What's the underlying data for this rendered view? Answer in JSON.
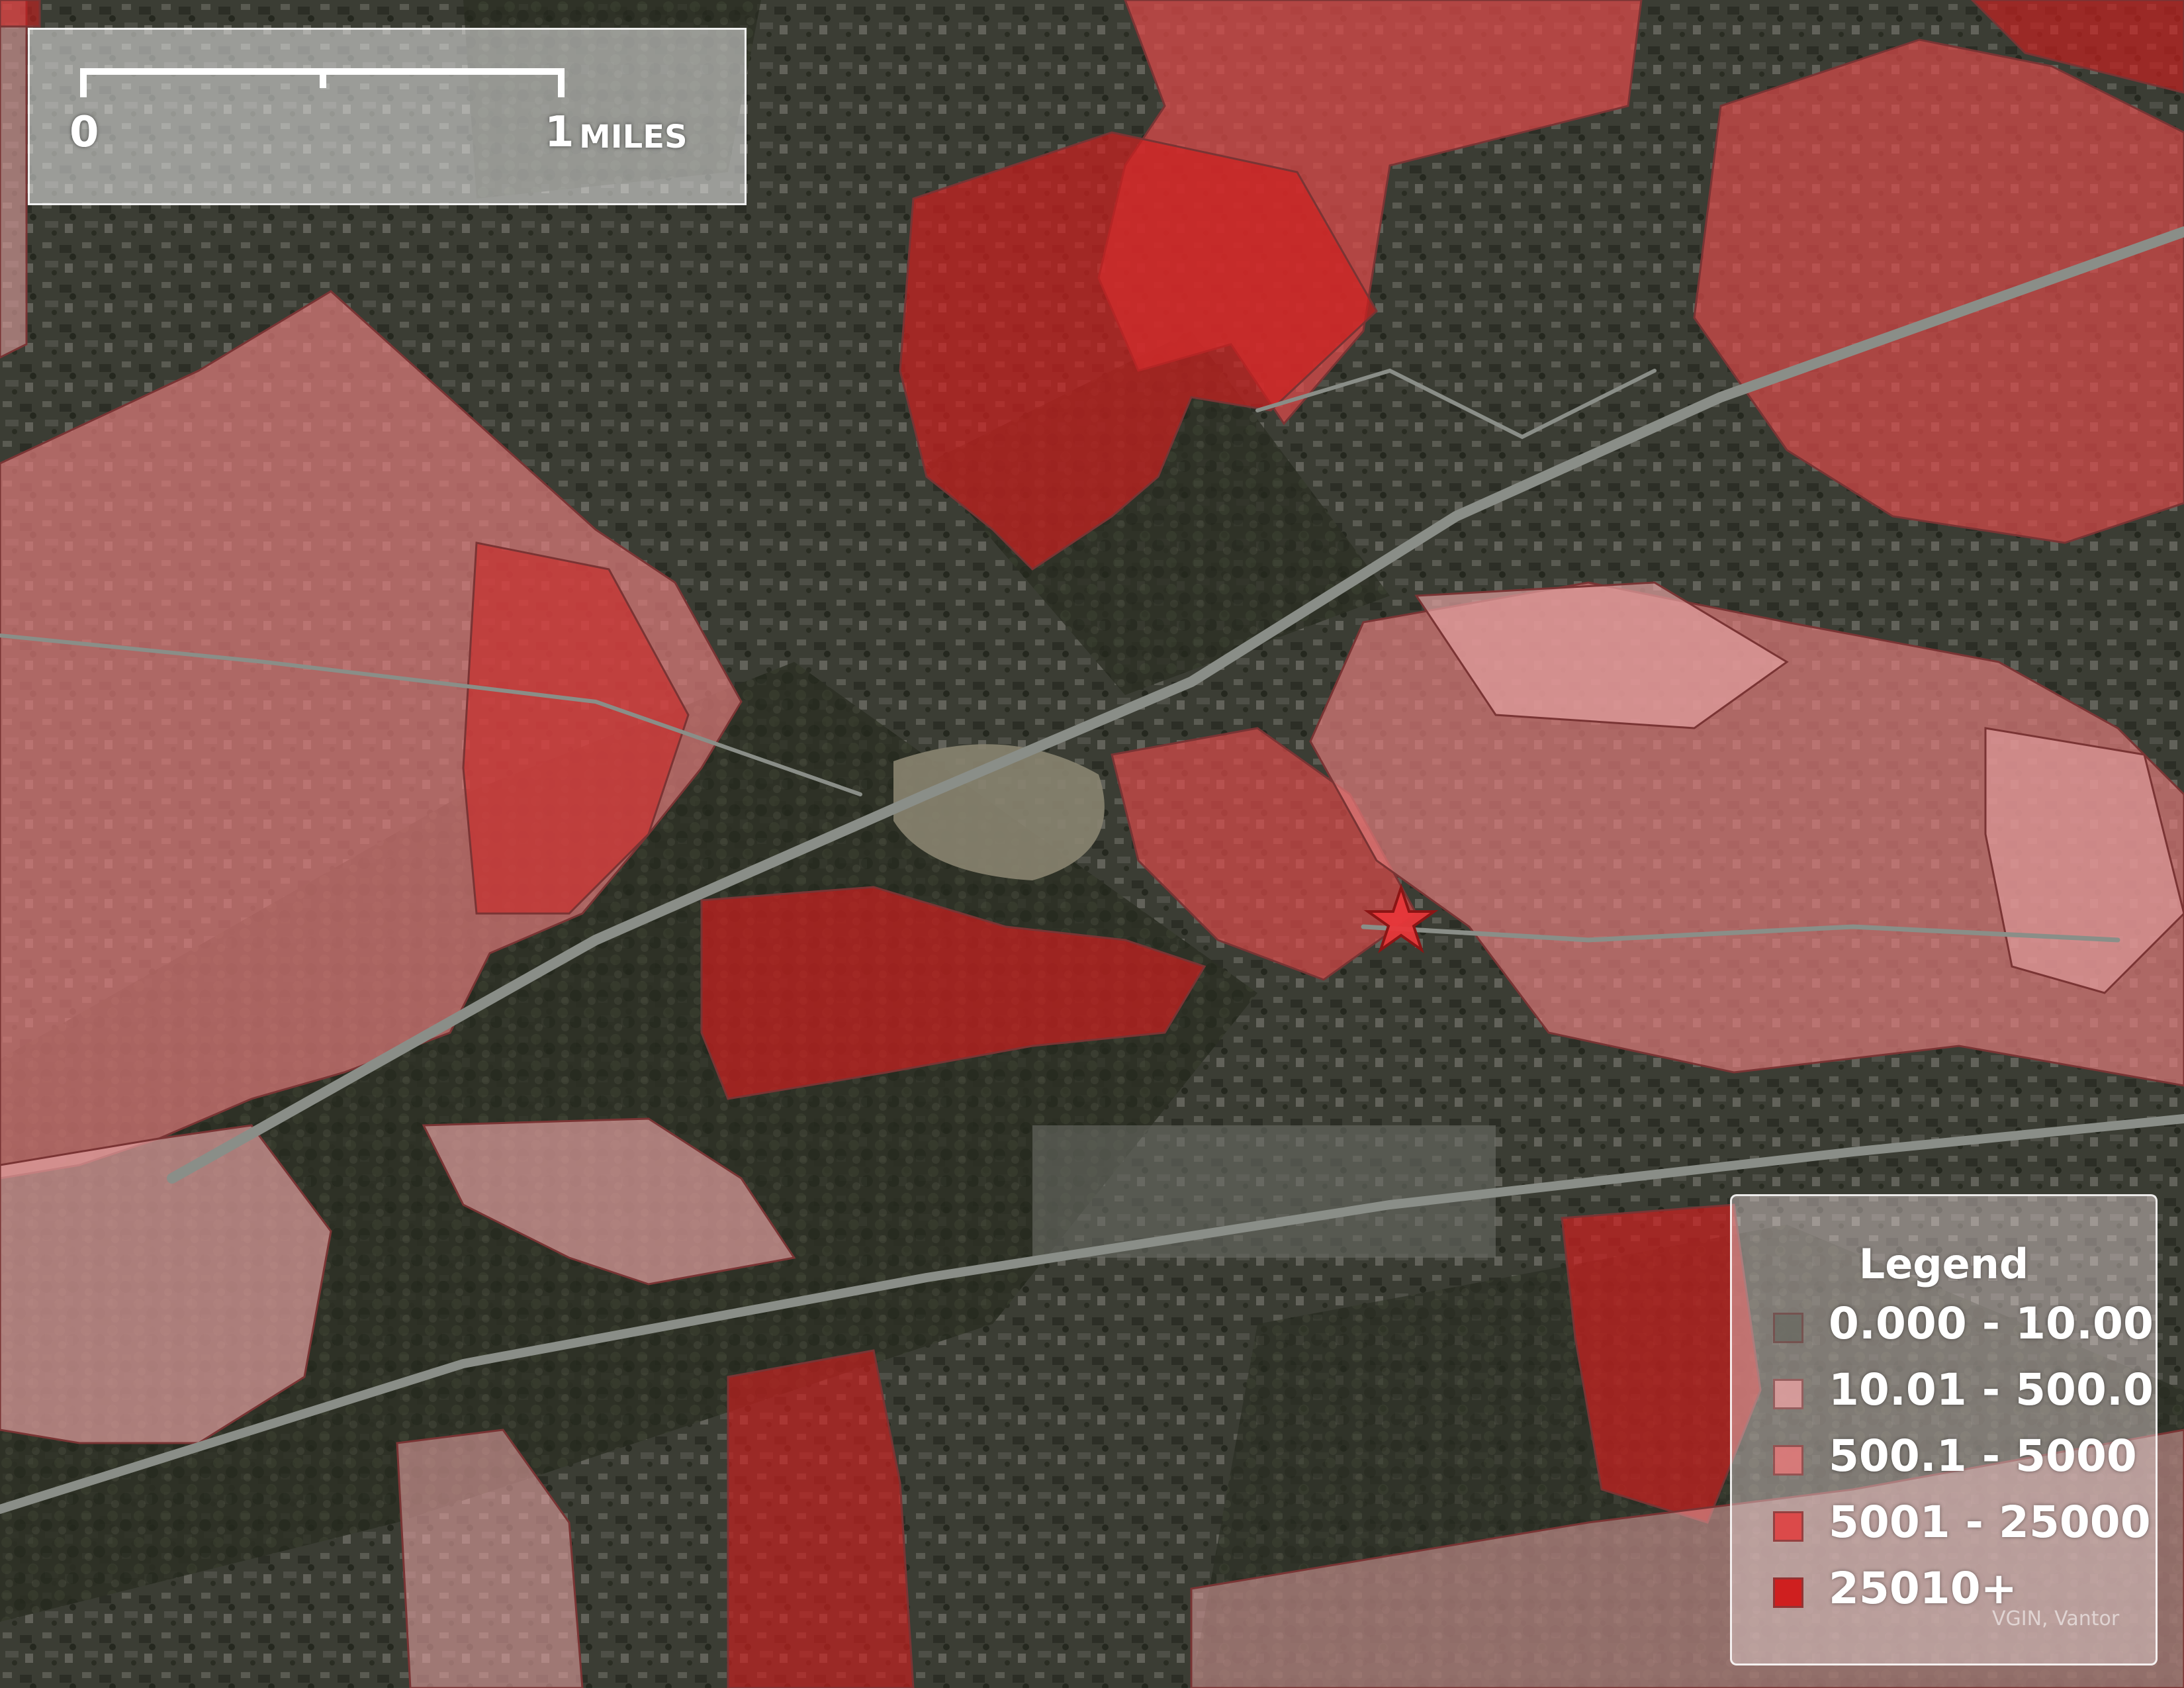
{
  "scale_bar": {
    "start_label": "0",
    "end_label": "1",
    "unit_label": "MILES"
  },
  "legend": {
    "title": "Legend",
    "items": [
      {
        "label": "0.000 - 10.00",
        "color": "#6a6a62"
      },
      {
        "label": "10.01 - 500.0",
        "color": "#e3a0a0"
      },
      {
        "label": "500.1 - 5000",
        "color": "#e07a7a"
      },
      {
        "label": "5001 - 25000",
        "color": "#db4a4a"
      },
      {
        "label": "25010+",
        "color": "#cf1f1f"
      }
    ]
  },
  "credit": "VGIN, Vantor",
  "marker": {
    "type": "star",
    "color": "#e8373a"
  },
  "colors": {
    "imagery": "#3a3c33",
    "road": "#8a8e88",
    "boundary": "#7a3434"
  }
}
